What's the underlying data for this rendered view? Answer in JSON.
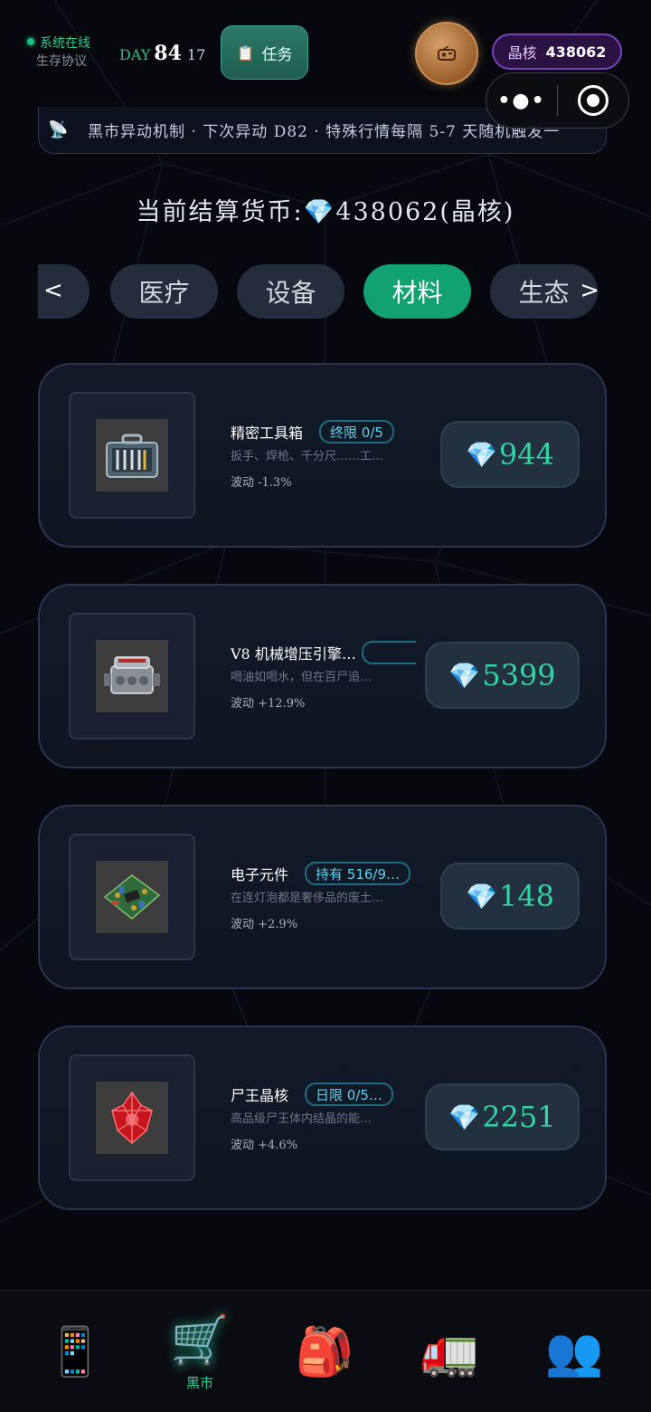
{
  "status": {
    "online_label": "系统在线",
    "protocol_label": "生存协议",
    "day_label": "DAY",
    "day_number": "84",
    "hour": "17",
    "task_icon": "clipboard-icon",
    "task_label": "任务",
    "crystal_label": "晶核",
    "crystal_value": "438062"
  },
  "ticker": {
    "icon": "satellite-icon",
    "text": "黑市异动机制 · 下次异动 D82 · 特殊行情每隔 5-7 天随机触发一"
  },
  "currency_line": {
    "prefix": "当前结算货币:",
    "amount": "438062",
    "unit": "(晶核)"
  },
  "tabs": [
    {
      "label": "医疗",
      "active": false
    },
    {
      "label": "设备",
      "active": false
    },
    {
      "label": "材料",
      "active": true
    },
    {
      "label": "生态",
      "active": false
    }
  ],
  "items": [
    {
      "name": "精密工具箱",
      "tag": "终限 0/5",
      "desc": "扳手、焊枪、千分尺……工…",
      "fluct": "波动 -1.3%",
      "price": "944",
      "icon": "toolbox-icon"
    },
    {
      "name": "V8 机械增压引擎…",
      "tag": "",
      "desc": "喝油如喝水，但在百尸追…",
      "fluct": "波动 +12.9%",
      "price": "5399",
      "icon": "engine-icon"
    },
    {
      "name": "电子元件",
      "tag": "持有 516/9…",
      "desc": "在连灯泡都是奢侈品的废土…",
      "fluct": "波动 +2.9%",
      "price": "148",
      "icon": "circuit-board-icon"
    },
    {
      "name": "尸王晶核",
      "tag": "日限 0/5…",
      "desc": "高品级尸王体内结晶的能…",
      "fluct": "波动 +4.6%",
      "price": "2251",
      "icon": "red-crystal-icon"
    }
  ],
  "nav": [
    {
      "icon": "phone-icon",
      "label": ""
    },
    {
      "icon": "shopping-cart-icon",
      "label": "黑市"
    },
    {
      "icon": "backpack-icon",
      "label": ""
    },
    {
      "icon": "truck-icon",
      "label": ""
    },
    {
      "icon": "people-icon",
      "label": ""
    }
  ]
}
